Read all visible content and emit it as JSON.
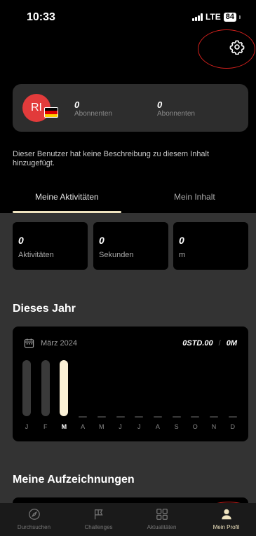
{
  "status_bar": {
    "time": "10:33",
    "network": "LTE",
    "battery": "84"
  },
  "profile": {
    "initials": "RI",
    "flag_colors": [
      "#000000",
      "#dd0000",
      "#ffce00"
    ],
    "stats": [
      {
        "value": "0",
        "label": "Abonnenten"
      },
      {
        "value": "0",
        "label": "Abonnenten"
      }
    ],
    "description": "Dieser Benutzer hat keine Beschreibung zu diesem Inhalt hinzugefügt."
  },
  "tabs": [
    {
      "label": "Meine Aktivitäten",
      "active": true
    },
    {
      "label": "Mein Inhalt",
      "active": false
    }
  ],
  "summary": [
    {
      "value": "0",
      "label": "Aktivitäten"
    },
    {
      "value": "0",
      "label": "Sekunden"
    },
    {
      "value": "0",
      "label": "m"
    }
  ],
  "year_section": {
    "title": "Dieses Jahr",
    "month_label": "März 2024",
    "total_time": "0STD.00",
    "separator": "/",
    "total_distance": "0M"
  },
  "chart_data": {
    "type": "bar",
    "categories": [
      "J",
      "F",
      "M",
      "A",
      "M",
      "J",
      "J",
      "A",
      "S",
      "O",
      "N",
      "D"
    ],
    "values": [
      1,
      1,
      1,
      0,
      0,
      0,
      0,
      0,
      0,
      0,
      0,
      0
    ],
    "highlighted_index": 2,
    "ylim": [
      0,
      1
    ],
    "colors": {
      "past": "#3a3a3a",
      "current": "#fbf1d6",
      "empty": "#3a3a3a"
    }
  },
  "records_section": {
    "title": "Meine Aufzeichnungen"
  },
  "bottom_nav": [
    {
      "label": "Durchsuchen",
      "icon": "compass-icon",
      "active": false
    },
    {
      "label": "Challenges",
      "icon": "flag-icon",
      "active": false
    },
    {
      "label": "Aktualitäten",
      "icon": "grid-icon",
      "active": false
    },
    {
      "label": "Mein Profil",
      "icon": "person-icon",
      "active": true
    }
  ],
  "colors": {
    "accent": "#f0e4c0",
    "annotation": "#d0201c",
    "card": "#2d2d2d",
    "panel": "#333333"
  }
}
